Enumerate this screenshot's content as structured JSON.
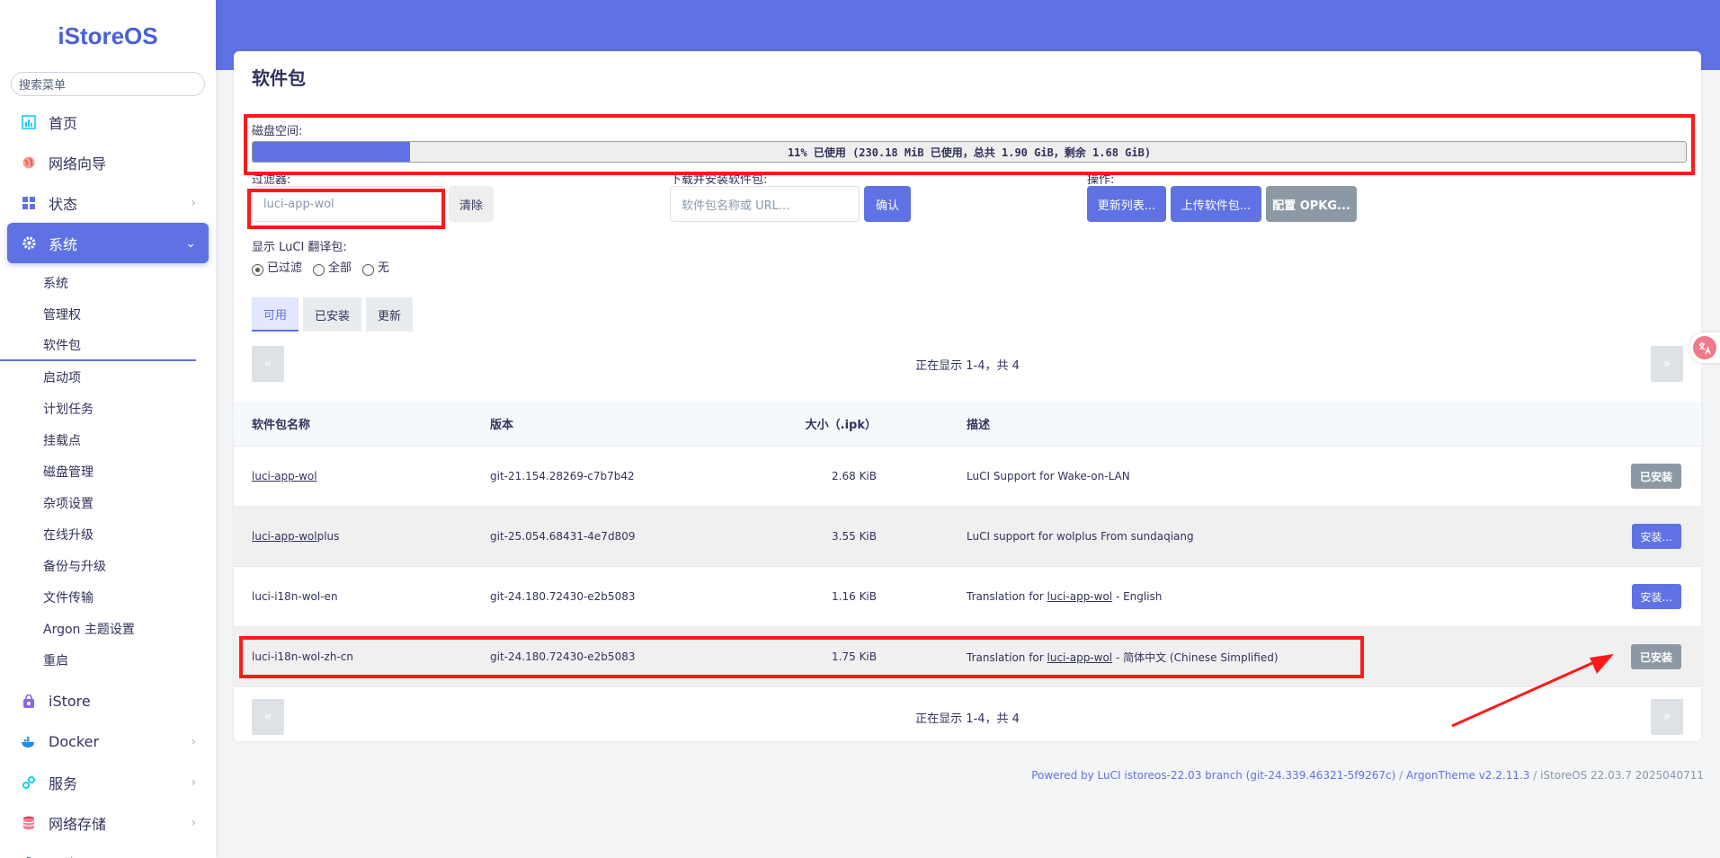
{
  "brand": "iStoreOS",
  "search_placeholder": "搜索菜单",
  "menu": {
    "home": "首页",
    "wizard": "网络向导",
    "status": "状态",
    "system": "系统",
    "istore": "iStore",
    "docker": "Docker",
    "services": "服务",
    "nas": "网络存储",
    "network": "网络"
  },
  "submenu": [
    "系统",
    "管理权",
    "软件包",
    "启动项",
    "计划任务",
    "挂载点",
    "磁盘管理",
    "杂项设置",
    "在线升级",
    "备份与升级",
    "文件传输",
    "Argon 主题设置",
    "重启"
  ],
  "page": {
    "title": "软件包",
    "disk_label": "磁盘空间:",
    "disk_usage_text": "11% 已使用 (230.18 MiB 已使用，总共 1.90 GiB，剩余 1.68 GiB)",
    "disk_usage_percent": 11,
    "filter_label": "过滤器:",
    "filter_value": "luci-app-wol",
    "clear_btn": "清除",
    "download_label": "下载并安装软件包:",
    "download_placeholder": "软件包名称或 URL...",
    "confirm_btn": "确认",
    "actions_label": "操作:",
    "update_btn": "更新列表...",
    "upload_btn": "上传软件包...",
    "config_btn": "配置 OPKG...",
    "i18n_label": "显示 LuCI 翻译包:",
    "radio_filtered": "已过滤",
    "radio_all": "全部",
    "radio_none": "无",
    "tab_available": "可用",
    "tab_installed": "已安装",
    "tab_updates": "更新",
    "pager_prev": "«",
    "pager_next": "»",
    "pager_text": "正在显示 1-4，共 4"
  },
  "table": {
    "headers": {
      "name": "软件包名称",
      "version": "版本",
      "size": "大小（.ipk）",
      "desc": "描述"
    },
    "rows": [
      {
        "name": "luci-app-wol",
        "version": "git-21.154.28269-c7b7b42",
        "size": "2.68 KiB",
        "desc": "LuCI Support for Wake-on-LAN",
        "action": "已安装"
      },
      {
        "name_u": "luci-app-wol",
        "name_rest": "plus",
        "version": "git-25.054.68431-4e7d809",
        "size": "3.55 KiB",
        "desc": "LuCI support for wolplus From sundaqiang",
        "action": "安装..."
      },
      {
        "name": "luci-i18n-wol-en",
        "version": "git-24.180.72430-e2b5083",
        "size": "1.16 KiB",
        "desc_pre": "Translation for ",
        "desc_link": "luci-app-wol",
        "desc_post": " - English",
        "action": "安装..."
      },
      {
        "name": "luci-i18n-wol-zh-cn",
        "version": "git-24.180.72430-e2b5083",
        "size": "1.75 KiB",
        "desc_pre": "Translation for ",
        "desc_link": "luci-app-wol",
        "desc_post": " - 简体中文 (Chinese Simplified)",
        "action": "已安装"
      }
    ]
  },
  "footer": {
    "powered": "Powered by LuCI istoreos-22.03 branch (git-24.339.46321-5f9267c)",
    "sep": " / ",
    "theme": "ArgonTheme v2.2.11.3",
    "version": " / iStoreOS 22.03.7 2025040711"
  },
  "colors": {
    "accent": "#5e72e4",
    "annotation": "#ff1a1a"
  }
}
